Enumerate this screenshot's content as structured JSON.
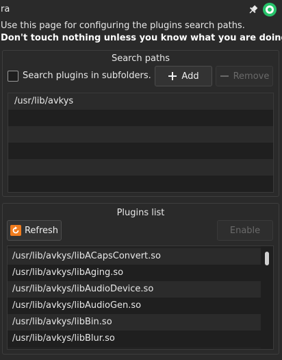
{
  "window": {
    "title": "ra"
  },
  "intro": {
    "line1": "Use this page for configuring the plugins search paths.",
    "line2": "Don't touch nothing unless you know what you are doing",
    "line2_end": "."
  },
  "search_paths": {
    "title": "Search paths",
    "subfolders_label": "Search plugins in subfolders.",
    "subfolders_checked": false,
    "add_label": "Add",
    "remove_label": "Remove",
    "paths": [
      "/usr/lib/avkys"
    ]
  },
  "plugins_list": {
    "title": "Plugins list",
    "refresh_label": "Refresh",
    "enable_label": "Enable",
    "items": [
      "/usr/lib/avkys/libACapsConvert.so",
      "/usr/lib/avkys/libAging.so",
      "/usr/lib/avkys/libAudioDevice.so",
      "/usr/lib/avkys/libAudioGen.so",
      "/usr/lib/avkys/libBin.so",
      "/usr/lib/avkys/libBlur.so"
    ]
  },
  "icons": {
    "pin": "pin-icon",
    "app": "app-icon",
    "add": "plus-icon",
    "remove": "minus-icon",
    "refresh": "refresh-icon"
  },
  "colors": {
    "background": "#2a2a2a",
    "refresh_icon": "#f07c1e",
    "app_icon": "#27c36a"
  }
}
